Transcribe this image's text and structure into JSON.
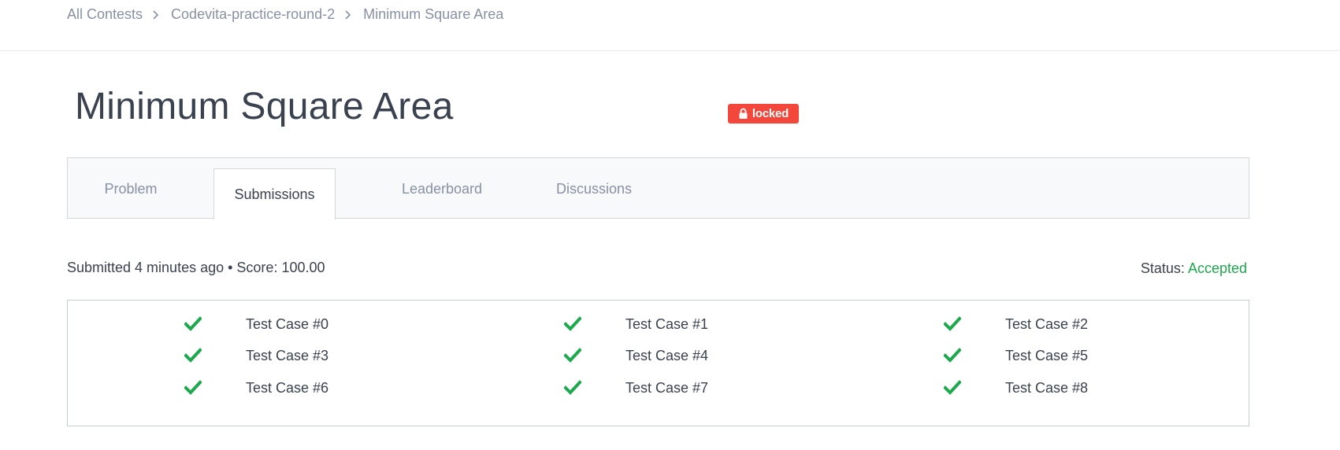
{
  "breadcrumb": {
    "items": [
      "All Contests",
      "Codevita-practice-round-2",
      "Minimum Square Area"
    ]
  },
  "page": {
    "title": "Minimum Square Area",
    "badge": "locked"
  },
  "tabs": [
    {
      "label": "Problem",
      "active": false
    },
    {
      "label": "Submissions",
      "active": true
    },
    {
      "label": "Leaderboard",
      "active": false
    },
    {
      "label": "Discussions",
      "active": false
    }
  ],
  "submission": {
    "summary": "Submitted 4 minutes ago • Score: 100.00",
    "status_label": "Status:",
    "status_value": "Accepted"
  },
  "test_cases": [
    {
      "label": "Test Case #0",
      "passed": true
    },
    {
      "label": "Test Case #1",
      "passed": true
    },
    {
      "label": "Test Case #2",
      "passed": true
    },
    {
      "label": "Test Case #3",
      "passed": true
    },
    {
      "label": "Test Case #4",
      "passed": true
    },
    {
      "label": "Test Case #5",
      "passed": true
    },
    {
      "label": "Test Case #6",
      "passed": true
    },
    {
      "label": "Test Case #7",
      "passed": true
    },
    {
      "label": "Test Case #8",
      "passed": true
    }
  ],
  "colors": {
    "accent_green": "#1ba94c",
    "locked_red": "#f2473a",
    "text": "#39424e",
    "muted": "#8891a3"
  },
  "icons": {
    "breadcrumb_separator": "chevron-right-icon",
    "badge": "lock-icon",
    "test_status": "check-icon"
  }
}
